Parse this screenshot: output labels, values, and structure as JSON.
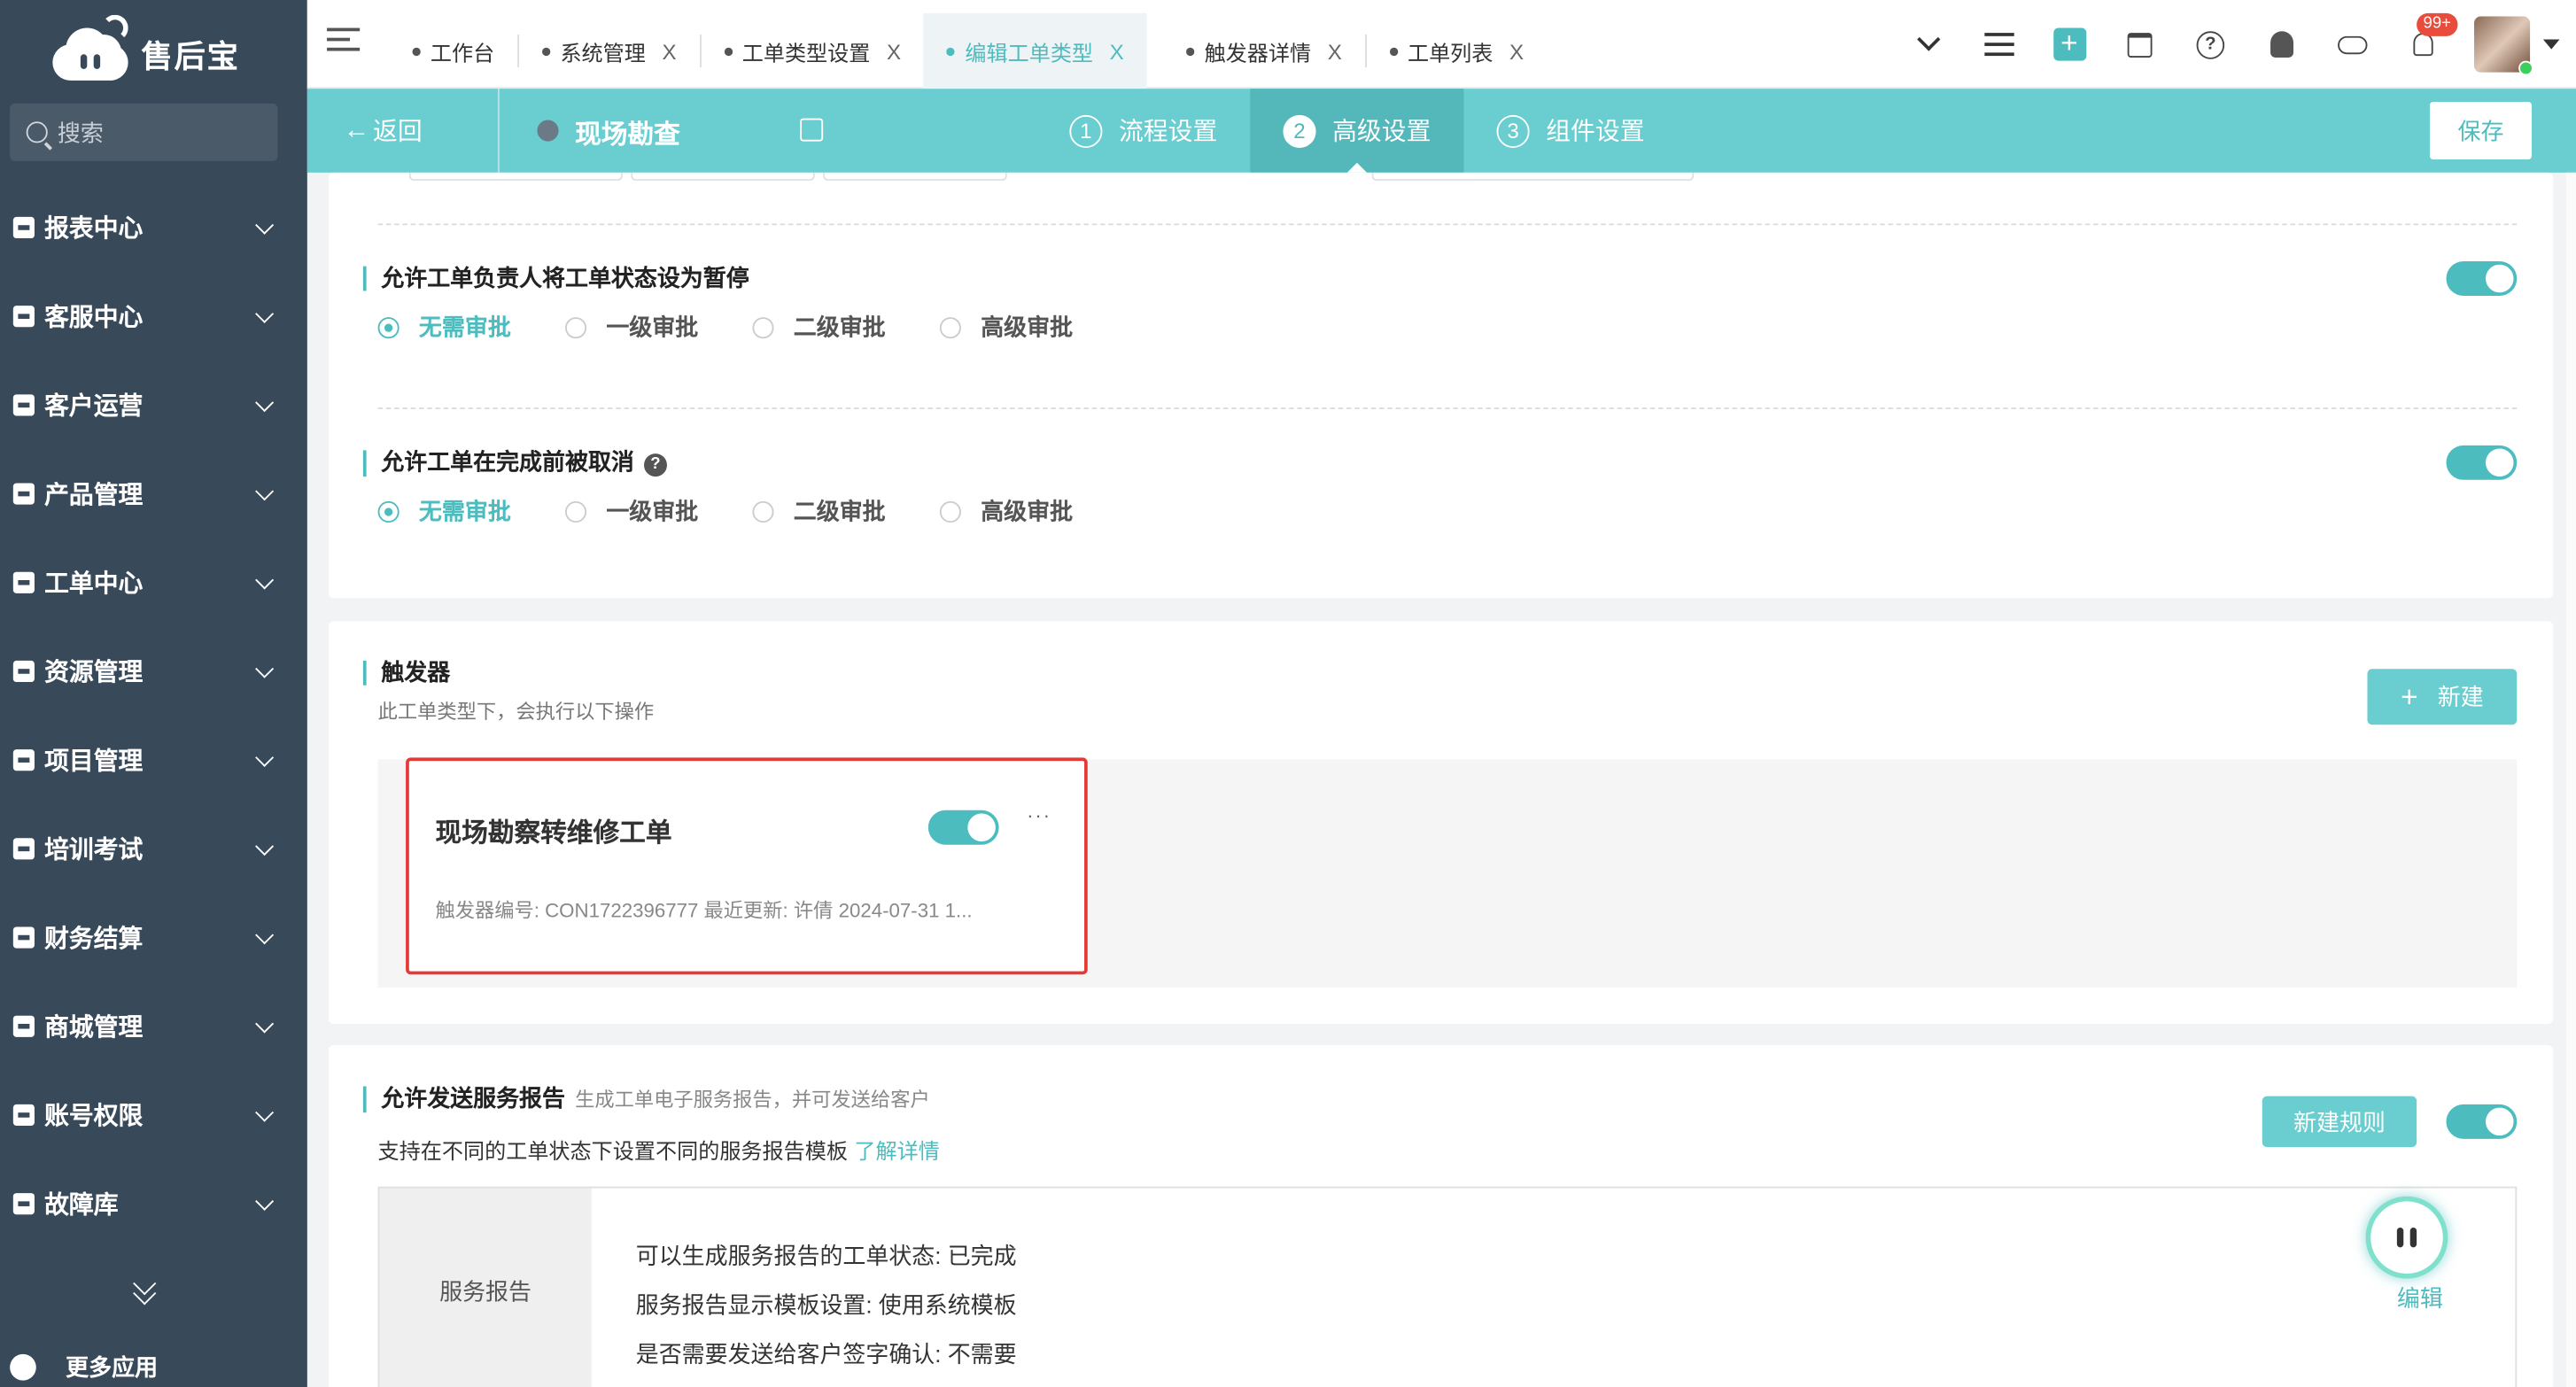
{
  "app": {
    "name": "售后宝"
  },
  "sidebar": {
    "search_placeholder": "搜索",
    "items": [
      {
        "label": "报表中心",
        "icon": "report-icon"
      },
      {
        "label": "客服中心",
        "icon": "home-icon"
      },
      {
        "label": "客户运营",
        "icon": "customer-icon"
      },
      {
        "label": "产品管理",
        "icon": "product-icon"
      },
      {
        "label": "工单中心",
        "icon": "ticket-icon"
      },
      {
        "label": "资源管理",
        "icon": "resource-icon"
      },
      {
        "label": "项目管理",
        "icon": "project-icon"
      },
      {
        "label": "培训考试",
        "icon": "training-icon"
      },
      {
        "label": "财务结算",
        "icon": "finance-icon"
      },
      {
        "label": "商城管理",
        "icon": "mall-icon"
      },
      {
        "label": "账号权限",
        "icon": "account-icon"
      },
      {
        "label": "故障库",
        "icon": "fault-icon"
      }
    ],
    "more_apps": "更多应用"
  },
  "tabs": [
    {
      "label": "工作台",
      "closable": false,
      "active": false
    },
    {
      "label": "系统管理",
      "closable": true,
      "active": false
    },
    {
      "label": "工单类型设置",
      "closable": true,
      "active": false
    },
    {
      "label": "编辑工单类型",
      "closable": true,
      "active": true
    },
    {
      "label": "触发器详情",
      "closable": true,
      "active": false
    },
    {
      "label": "工单列表",
      "closable": true,
      "active": false
    }
  ],
  "topbar": {
    "notification_badge": "99+",
    "plus": "+",
    "help": "?"
  },
  "subbar": {
    "back_label": "返回",
    "type_name": "现场勘查",
    "steps": [
      {
        "num": "1",
        "label": "流程设置",
        "active": false
      },
      {
        "num": "2",
        "label": "高级设置",
        "active": true
      },
      {
        "num": "3",
        "label": "组件设置",
        "active": false
      }
    ],
    "save_label": "保存"
  },
  "pause_section": {
    "title": "允许工单负责人将工单状态设为暂停",
    "enabled": true,
    "options": [
      "无需审批",
      "一级审批",
      "二级审批",
      "高级审批"
    ],
    "selected": "无需审批"
  },
  "cancel_section": {
    "title": "允许工单在完成前被取消",
    "enabled": true,
    "options": [
      "无需审批",
      "一级审批",
      "二级审批",
      "高级审批"
    ],
    "selected": "无需审批"
  },
  "trigger_section": {
    "title": "触发器",
    "subtitle": "此工单类型下，会执行以下操作",
    "new_label": "新建",
    "triggers": [
      {
        "name": "现场勘察转维修工单",
        "enabled": true,
        "more": "···",
        "meta": "触发器编号: CON1722396777   最近更新: 许倩   2024-07-31 1..."
      }
    ]
  },
  "report_section": {
    "title": "允许发送服务报告",
    "subtitle": "生成工单电子服务报告，并可发送给客户",
    "new_rule_label": "新建规则",
    "enabled": true,
    "hint": "支持在不同的工单状态下设置不同的服务报告模板",
    "hint_link": "了解详情",
    "box_label": "服务报告",
    "lines": [
      "可以生成服务报告的工单状态: 已完成",
      "服务报告显示模板设置: 使用系统模板",
      "是否需要发送给客户签字确认: 不需要"
    ],
    "edit_label": "编辑"
  },
  "colors": {
    "accent": "#4cbcbf",
    "sidebar_bg": "#38495a",
    "highlight": "#e53935"
  }
}
